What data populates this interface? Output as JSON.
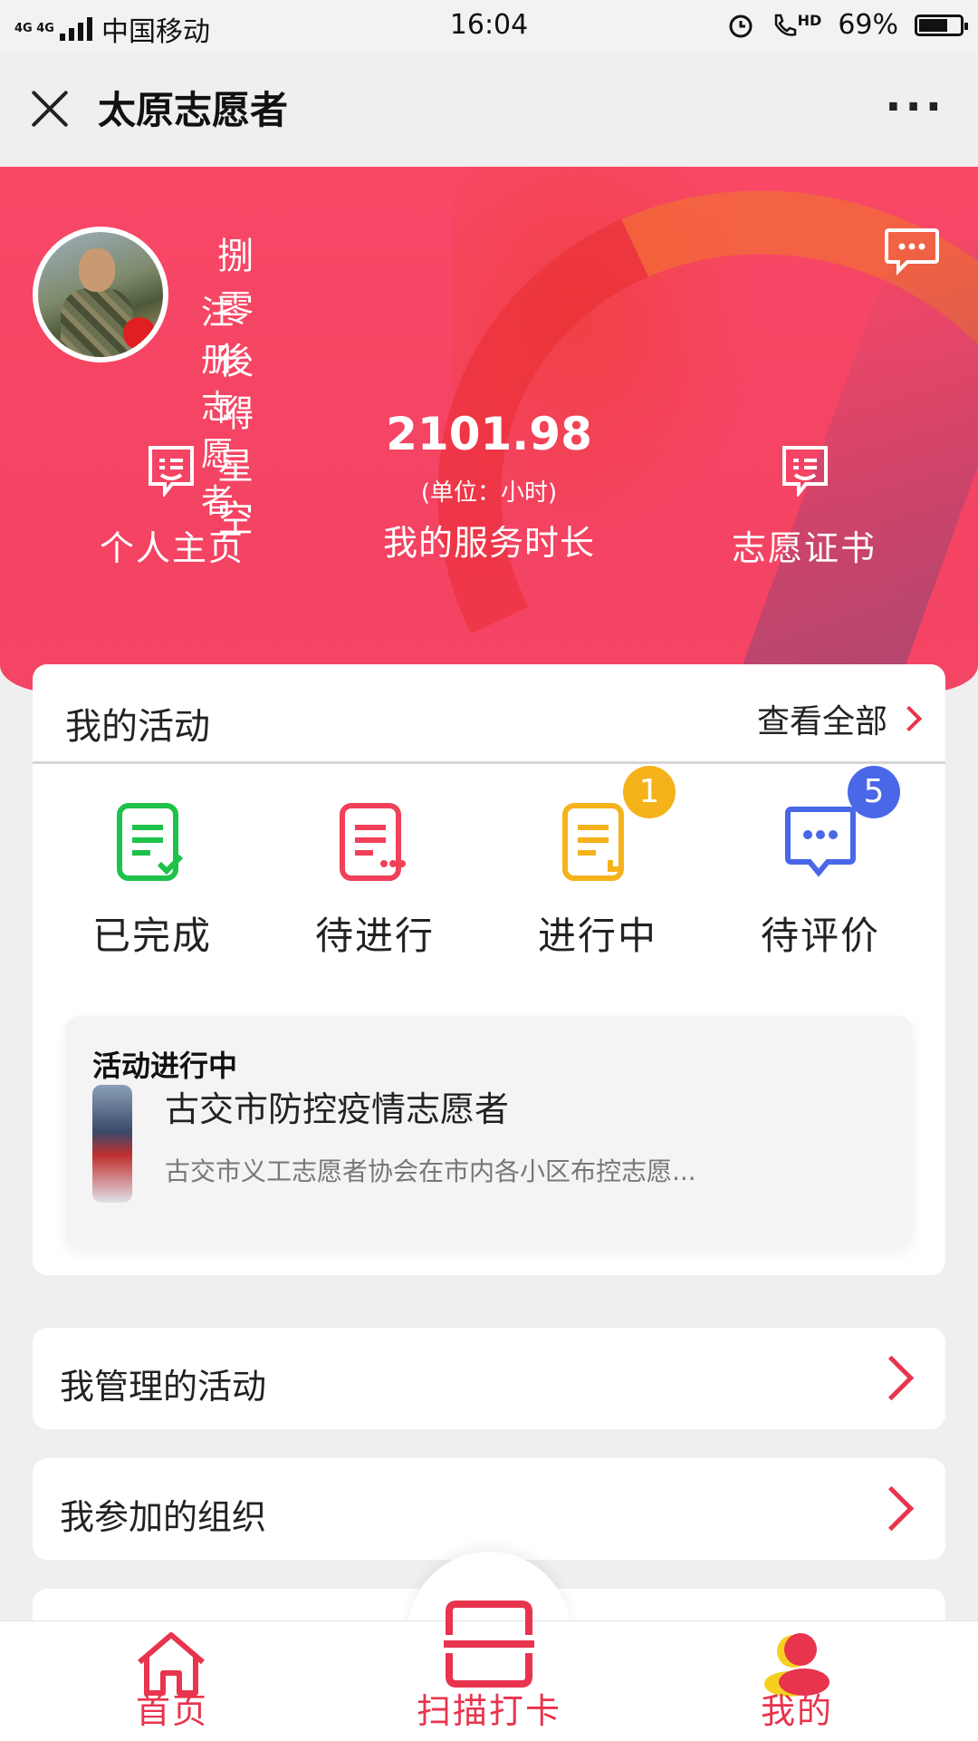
{
  "status_bar": {
    "network": "4G 4G",
    "carrier": "中国移动",
    "time": "16:04",
    "battery": "69%",
    "hd": "HD"
  },
  "nav": {
    "title": "太原志愿者",
    "more": "···"
  },
  "profile": {
    "name": "捌零後嘚星空",
    "role": "注册志愿者",
    "service_hours": "2101.98",
    "hours_unit": "(单位：小时)",
    "hours_label": "我的服务时长",
    "home_label": "个人主页",
    "cert_label": "志愿证书"
  },
  "activities": {
    "title": "我的活动",
    "view_all": "查看全部",
    "statuses": [
      {
        "label": "已完成",
        "color": "#1ec24a"
      },
      {
        "label": "待进行",
        "color": "#f0405a"
      },
      {
        "label": "进行中",
        "color": "#f5b21a",
        "badge": "1"
      },
      {
        "label": "待评价",
        "color": "#4a67e8",
        "badge": "5"
      }
    ],
    "ongoing": {
      "tag": "活动进行中",
      "title": "古交市防控疫情志愿者",
      "desc": "古交市义工志愿者协会在市内各小区布控志愿..."
    }
  },
  "menu": {
    "managed_activities": "我管理的活动",
    "joined_orgs": "我参加的组织"
  },
  "tabbar": {
    "home": "首页",
    "scan": "扫描打卡",
    "mine": "我的"
  },
  "colors": {
    "accent": "#e8344d",
    "hero": "#f44363",
    "badge_yellow": "#f5b21a",
    "badge_blue": "#4a67e8"
  }
}
